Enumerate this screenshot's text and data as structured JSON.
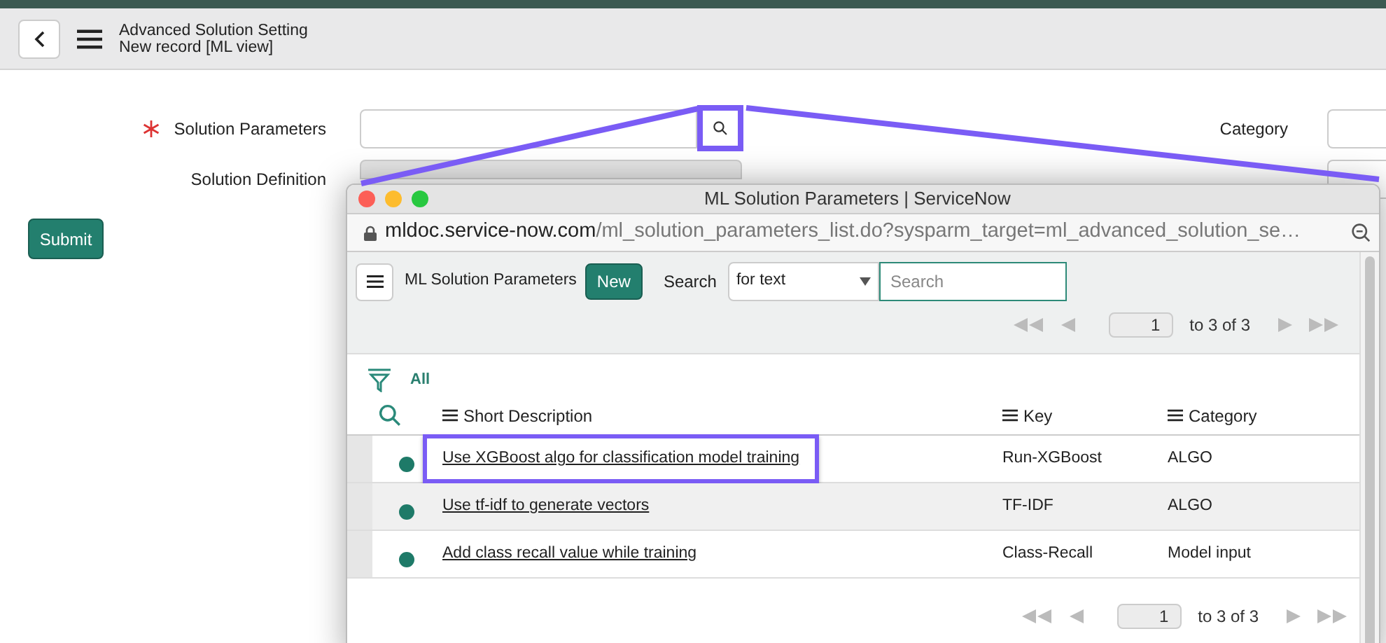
{
  "header": {
    "title": "Advanced Solution Setting",
    "subtitle": "New record [ML view]"
  },
  "form": {
    "left": [
      {
        "label": "Solution Parameters",
        "required": true,
        "kind": "lookup",
        "highlighted": true
      },
      {
        "label": "Solution Definition",
        "required": false,
        "kind": "readonly"
      }
    ],
    "right": [
      {
        "label": "Category"
      }
    ],
    "submit": "Submit"
  },
  "popup": {
    "title": "ML Solution Parameters | ServiceNow",
    "url_host": "mldoc.service-now.com",
    "url_path": "/ml_solution_parameters_list.do?sysparm_target=ml_advanced_solution_se…",
    "list_title": "ML Solution Parameters",
    "new_button": "New",
    "search_label": "Search",
    "search_type": "for text",
    "search_placeholder": "Search",
    "pager_top": {
      "page": "1",
      "range": "to 3 of 3"
    },
    "filter": "All",
    "columns": [
      "Short Description",
      "Key",
      "Category"
    ],
    "rows": [
      {
        "description": "Use XGBoost algo for classification model training",
        "key": "Run-XGBoost",
        "category": "ALGO",
        "highlighted": true
      },
      {
        "description": "Use tf-idf to generate vectors",
        "key": "TF-IDF",
        "category": "ALGO",
        "highlighted": false
      },
      {
        "description": "Add class recall value while training",
        "key": "Class-Recall",
        "category": "Model input",
        "highlighted": false
      }
    ],
    "pager_bottom": {
      "page": "1",
      "range": "to 3 of 3"
    }
  }
}
